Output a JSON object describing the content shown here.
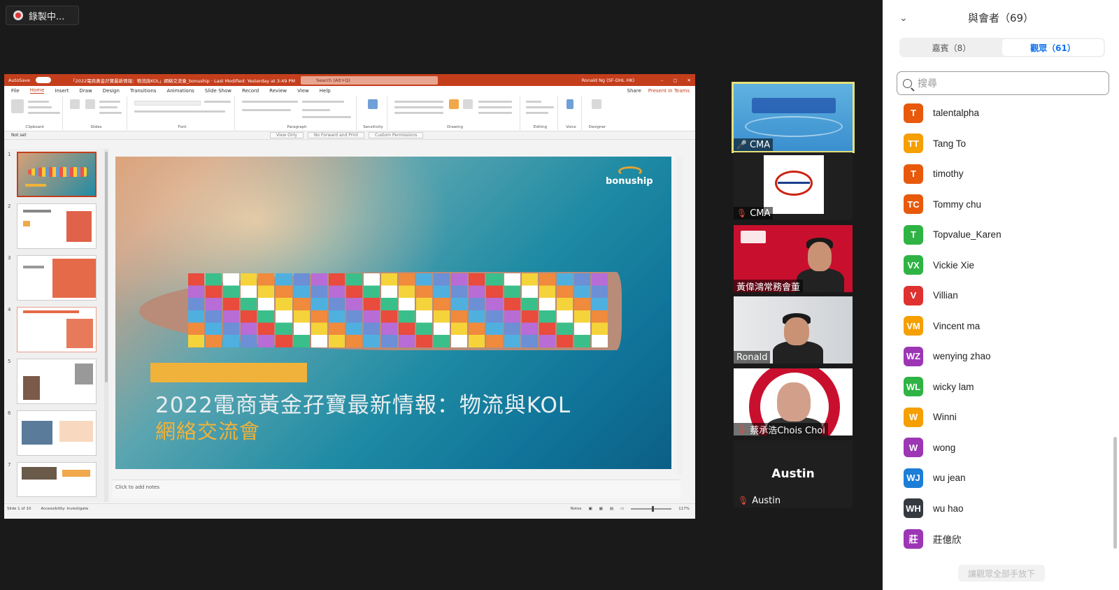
{
  "recording": {
    "label": "錄製中..."
  },
  "powerpoint": {
    "titlebar": {
      "autosave": "AutoSave",
      "doc_title": "「2022電商黃金孖寶最新情報：物流與KOL」網絡交流會_bonuship · Last Modified: Yesterday at 3:49 PM",
      "search_placeholder": "Search (Alt+Q)",
      "user": "Ronald Ng (SF-DHL HK)"
    },
    "tabs": [
      "File",
      "Home",
      "Insert",
      "Draw",
      "Design",
      "Transitions",
      "Animations",
      "Slide Show",
      "Record",
      "Review",
      "View",
      "Help"
    ],
    "active_tab": "Home",
    "share_label": "Share",
    "present_label": "Present in Teams",
    "ribbon_groups": [
      "Clipboard",
      "Slides",
      "Font",
      "Paragraph",
      "Sensitivity",
      "Drawing",
      "Editing",
      "Voice",
      "Designer"
    ],
    "ribbon_items": {
      "paste": "Paste",
      "new_slide": "New Slide",
      "reuse_slides": "Reuse Slides",
      "layout": "Layout",
      "reset": "Reset",
      "section": "Section",
      "find": "Find",
      "replace": "Replace",
      "select": "Select",
      "dictate": "Dictate",
      "design_ideas": "Design Ideas",
      "arrange": "Arrange",
      "sensitivity": "Sensitivity"
    },
    "sensitivity_bar": {
      "label": "Not set",
      "tags": [
        "View Only",
        "No Forward and Print",
        "Custom Permissions"
      ]
    },
    "slide": {
      "logo": "bonuship",
      "title_line1": "2022電商黃金孖寶最新情報：物流與KOL",
      "title_line2": "網絡交流會"
    },
    "notes_placeholder": "Click to add notes",
    "status": {
      "slide_count": "Slide 1 of 10",
      "accessibility": "Accessibility: Investigate",
      "notes": "Notes",
      "zoom": "117%"
    },
    "thumbnails": [
      "1",
      "2",
      "3",
      "4",
      "5",
      "6",
      "7"
    ]
  },
  "video_tiles": [
    {
      "name": "CMA",
      "muted": false,
      "active": true
    },
    {
      "name": "CMA",
      "muted": true
    },
    {
      "name": "黃偉鴻常務會董",
      "muted": false
    },
    {
      "name": "Ronald",
      "muted": false
    },
    {
      "name": "蔡承浩Chois Choi",
      "muted": true
    },
    {
      "name": "Austin",
      "muted": true,
      "center_name": "Austin"
    }
  ],
  "participants_panel": {
    "title": "與會者（69）",
    "tabs": [
      {
        "label": "嘉賓（8）",
        "active": false
      },
      {
        "label": "觀眾（61）",
        "active": true
      }
    ],
    "search_placeholder": "搜尋",
    "participants": [
      {
        "initials": "T",
        "name": "talentalpha",
        "color": "#e8590c"
      },
      {
        "initials": "TT",
        "name": "Tang To",
        "color": "#f59f00"
      },
      {
        "initials": "T",
        "name": "timothy",
        "color": "#e8590c"
      },
      {
        "initials": "TC",
        "name": "Tommy chu",
        "color": "#e8590c"
      },
      {
        "initials": "T",
        "name": "Topvalue_Karen",
        "color": "#2fb344"
      },
      {
        "initials": "VX",
        "name": "Vickie Xie",
        "color": "#2fb344"
      },
      {
        "initials": "V",
        "name": "Villian",
        "color": "#e03131"
      },
      {
        "initials": "VM",
        "name": "Vincent ma",
        "color": "#f59f00"
      },
      {
        "initials": "WZ",
        "name": "wenying zhao",
        "color": "#9c36b5"
      },
      {
        "initials": "WL",
        "name": "wicky lam",
        "color": "#2fb344"
      },
      {
        "initials": "W",
        "name": "Winni",
        "color": "#f59f00"
      },
      {
        "initials": "W",
        "name": "wong",
        "color": "#9c36b5"
      },
      {
        "initials": "WJ",
        "name": "wu  jean",
        "color": "#1c7ed6"
      },
      {
        "initials": "WH",
        "name": "wu hao",
        "color": "#343a40"
      },
      {
        "initials": "莊",
        "name": "莊億欣",
        "color": "#9c36b5"
      }
    ],
    "lower_all_hands": "讓觀眾全部手放下"
  }
}
